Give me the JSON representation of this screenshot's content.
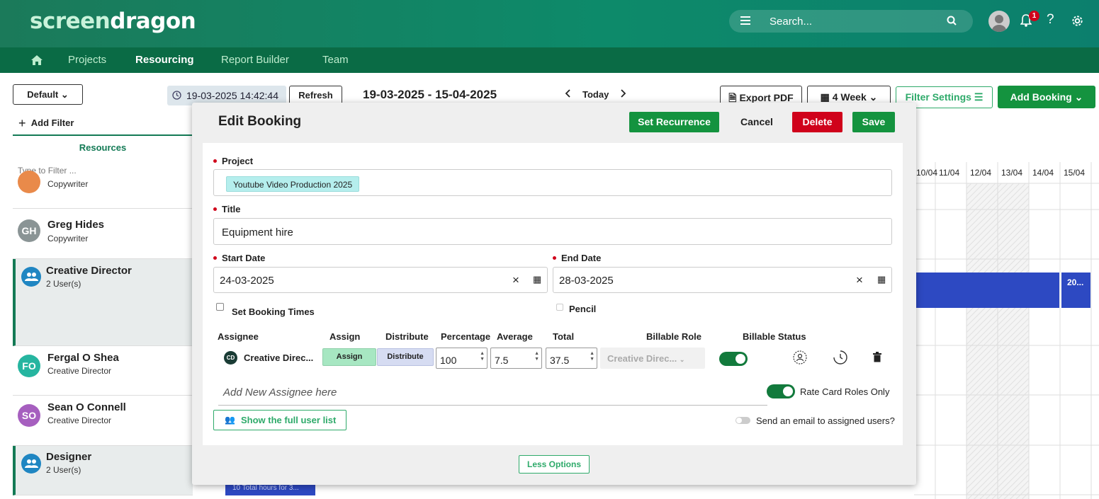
{
  "app": {
    "logo_part1": "screen",
    "logo_part2": "dragon",
    "search_placeholder": "Search...",
    "notification_count": "1"
  },
  "nav": {
    "items": [
      {
        "label": "Projects"
      },
      {
        "label": "Resourcing"
      },
      {
        "label": "Report Builder"
      },
      {
        "label": "Team"
      }
    ]
  },
  "toolbar": {
    "view_label": "Default",
    "timestamp": "19-03-2025 14:42:44",
    "refresh_label": "Refresh",
    "date_range": "19-03-2025 - 15-04-2025",
    "today_label": "Today",
    "export_label": "Export PDF",
    "weeks_label": "4 Week",
    "filter_label": "Filter Settings",
    "add_booking_label": "Add Booking",
    "add_filter_label": "Add Filter"
  },
  "resources": {
    "header": "Resources",
    "filter_placeholder": "Type to Filter ...",
    "rows": [
      {
        "name": "",
        "sub": "Copywriter"
      },
      {
        "initials": "GH",
        "name": "Greg Hides",
        "sub": "Copywriter"
      },
      {
        "name": "Creative Director",
        "sub": "2 User(s)"
      },
      {
        "initials": "FO",
        "name": "Fergal O Shea",
        "sub": "Creative Director"
      },
      {
        "initials": "SO",
        "name": "Sean O Connell",
        "sub": "Creative Director"
      },
      {
        "name": "Designer",
        "sub": "2 User(s)"
      }
    ]
  },
  "calendar": {
    "days": [
      "10/04",
      "11/04",
      "12/04",
      "13/04",
      "14/04",
      "15/04"
    ],
    "booking_label": "20...",
    "partial_booking_label": "10 Total hours for 3..."
  },
  "modal": {
    "title": "Edit Booking",
    "recurrence_label": "Set Recurrence",
    "cancel_label": "Cancel",
    "delete_label": "Delete",
    "save_label": "Save",
    "project_label": "Project",
    "project_value": "Youtube Video Production 2025",
    "title_label": "Title",
    "title_value": "Equipment hire",
    "start_label": "Start Date",
    "start_value": "24-03-2025",
    "end_label": "End Date",
    "end_value": "28-03-2025",
    "booking_times_label": "Set Booking Times",
    "pencil_label": "Pencil",
    "columns": {
      "assignee": "Assignee",
      "assign": "Assign",
      "distribute": "Distribute",
      "percentage": "Percentage",
      "average": "Average",
      "total": "Total",
      "billable_role": "Billable Role",
      "billable_status": "Billable Status"
    },
    "row": {
      "initials": "CD",
      "assignee": "Creative Direc...",
      "assign": "Assign",
      "distribute": "Distribute",
      "percentage": "100",
      "average": "7.5",
      "total": "37.5",
      "role": "Creative Direc..."
    },
    "add_assignee_placeholder": "Add New Assignee here",
    "rate_card_label": "Rate Card Roles Only",
    "show_users_label": "Show the full user list",
    "email_label": "Send an email to assigned users?",
    "less_options_label": "Less Options"
  },
  "colors": {
    "brand": "#0d8a6a",
    "nav": "#0a6b45",
    "save": "#14933f",
    "delete": "#d0021b",
    "booking": "#2d49c2"
  }
}
